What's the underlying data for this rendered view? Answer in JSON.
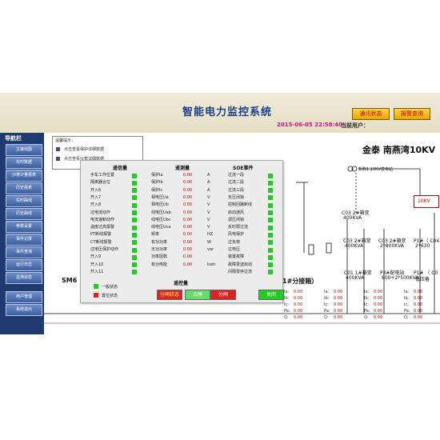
{
  "header": {
    "title": "智能电力监控系统",
    "comm_status": "通讯状态",
    "alarm_query": "报警查询",
    "datetime": "2015-06-05 22:58:40",
    "current_user_label": "当前用户："
  },
  "nav": {
    "title": "导航栏",
    "items": [
      "主接线图",
      "实时数据",
      "沙表计量报表",
      "历史报表",
      "实时曲线",
      "历史曲线",
      "参数设置",
      "事件记录",
      "事件查询",
      "运行日志",
      "遥测状态",
      "用户管理",
      "系统退出"
    ]
  },
  "tooltip": {
    "caption": "温馨提示：",
    "line1": "点击查看保护详细数据",
    "line2": "点击查看仪表详细数据"
  },
  "diagram": {
    "site_title": "金泰 南燕湾10KV",
    "cabinet_label": "新购1 10KV变电站",
    "box_label": "10KV",
    "sm6": "SM6",
    "switch_label": "1#分接箱）",
    "feeders": [
      {
        "name": "C03 2#箱变",
        "rating": "400KVA"
      },
      {
        "name": "C03 2#箱变",
        "rating": "400KVA"
      },
      {
        "name": "C03 2#箱变",
        "rating": "2*800KVA"
      },
      {
        "name": "P1#（ C04",
        "rating": "2*630"
      },
      {
        "name": "C01 1#箱变",
        "rating": "400KVA"
      },
      {
        "name": "P3#配电站",
        "rating": "800+2*500KVA"
      },
      {
        "name": "P1# （ C0",
        "rating": "低压备"
      }
    ],
    "meter_prefixes": [
      "Ia:",
      "Ib:",
      "Ic:",
      "Pa:",
      "Q:"
    ],
    "meter_value": "0.00"
  },
  "panel": {
    "col1_title": "遥信量",
    "col2_title": "遥测量",
    "col3_title": "SOE事件",
    "signals": [
      "手车工作位置",
      "隔离器合位",
      "开入6",
      "开入7",
      "开入8",
      "过电流动作",
      "电流速断动作",
      "温度过高报警",
      "PT断线报警",
      "CT断线报警",
      "过电压保护动作",
      "开入9",
      "开入10",
      "开入11"
    ],
    "measurements": [
      {
        "name": "保护Ia",
        "value": "0.00",
        "unit": "A"
      },
      {
        "name": "保护Ib",
        "value": "0.00",
        "unit": "A"
      },
      {
        "name": "保护Ic",
        "value": "0.00",
        "unit": "A"
      },
      {
        "name": "相电压Ua",
        "value": "0.00",
        "unit": "V"
      },
      {
        "name": "相电压Ub",
        "value": "0.00",
        "unit": "V"
      },
      {
        "name": "线电压Uab",
        "value": "0.00",
        "unit": "V"
      },
      {
        "name": "线电压Ubc",
        "value": "0.00",
        "unit": "V"
      },
      {
        "name": "线电压Uca",
        "value": "0.00",
        "unit": "V"
      },
      {
        "name": "频率",
        "value": "0.00",
        "unit": "HZ"
      },
      {
        "name": "有功功率",
        "value": "0.00",
        "unit": "W"
      },
      {
        "name": "无功功率",
        "value": "0.00",
        "unit": "var"
      },
      {
        "name": "功率因数",
        "value": "0.00",
        "unit": ""
      },
      {
        "name": "有功电能",
        "value": "0.00",
        "unit": "kwh"
      }
    ],
    "soe": [
      "过流一段",
      "过流二段",
      "过流三段",
      "负压闭锁",
      "控制回路断线",
      "启动通风",
      "调压闭锁",
      "反时限过流",
      "风电保护",
      "过负荷",
      "过电压",
      "装置故障",
      "故障录波启动",
      "间隔零序过流"
    ],
    "control_title": "遥控量",
    "legend_normal": "一般状态",
    "legend_alarm": "置位状态",
    "btn_open_close": "分闸状态",
    "btn_close": "合闸",
    "btn_open": "分闸",
    "btn_exit": "关闭"
  },
  "colors": {
    "on": "#22cc22",
    "alarm": "#dd2222",
    "header_title": "#1a3f8a",
    "datetime": "#c71585"
  }
}
